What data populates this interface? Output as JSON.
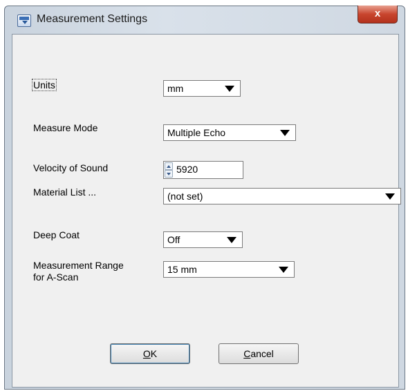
{
  "window": {
    "title": "Measurement Settings",
    "close_glyph": "x"
  },
  "form": {
    "units": {
      "label": "Units",
      "value": "mm"
    },
    "measure_mode": {
      "label": "Measure Mode",
      "value": "Multiple Echo"
    },
    "velocity": {
      "label": "Velocity of Sound",
      "value": "5920"
    },
    "material_list": {
      "label": "Material List ...",
      "value": "(not set)"
    },
    "deep_coat": {
      "label": "Deep Coat",
      "value": "Off"
    },
    "range": {
      "label_line1": "Measurement Range",
      "label_line2": "for A-Scan",
      "value": "15 mm"
    }
  },
  "buttons": {
    "ok": {
      "mnemonic": "O",
      "rest": "K"
    },
    "cancel": {
      "mnemonic": "C",
      "rest": "ancel"
    }
  },
  "icons": {
    "title": "app-window-icon",
    "close": "close-icon",
    "dropdown": "chevron-down-icon",
    "spin": "spin-arrows-icon"
  }
}
